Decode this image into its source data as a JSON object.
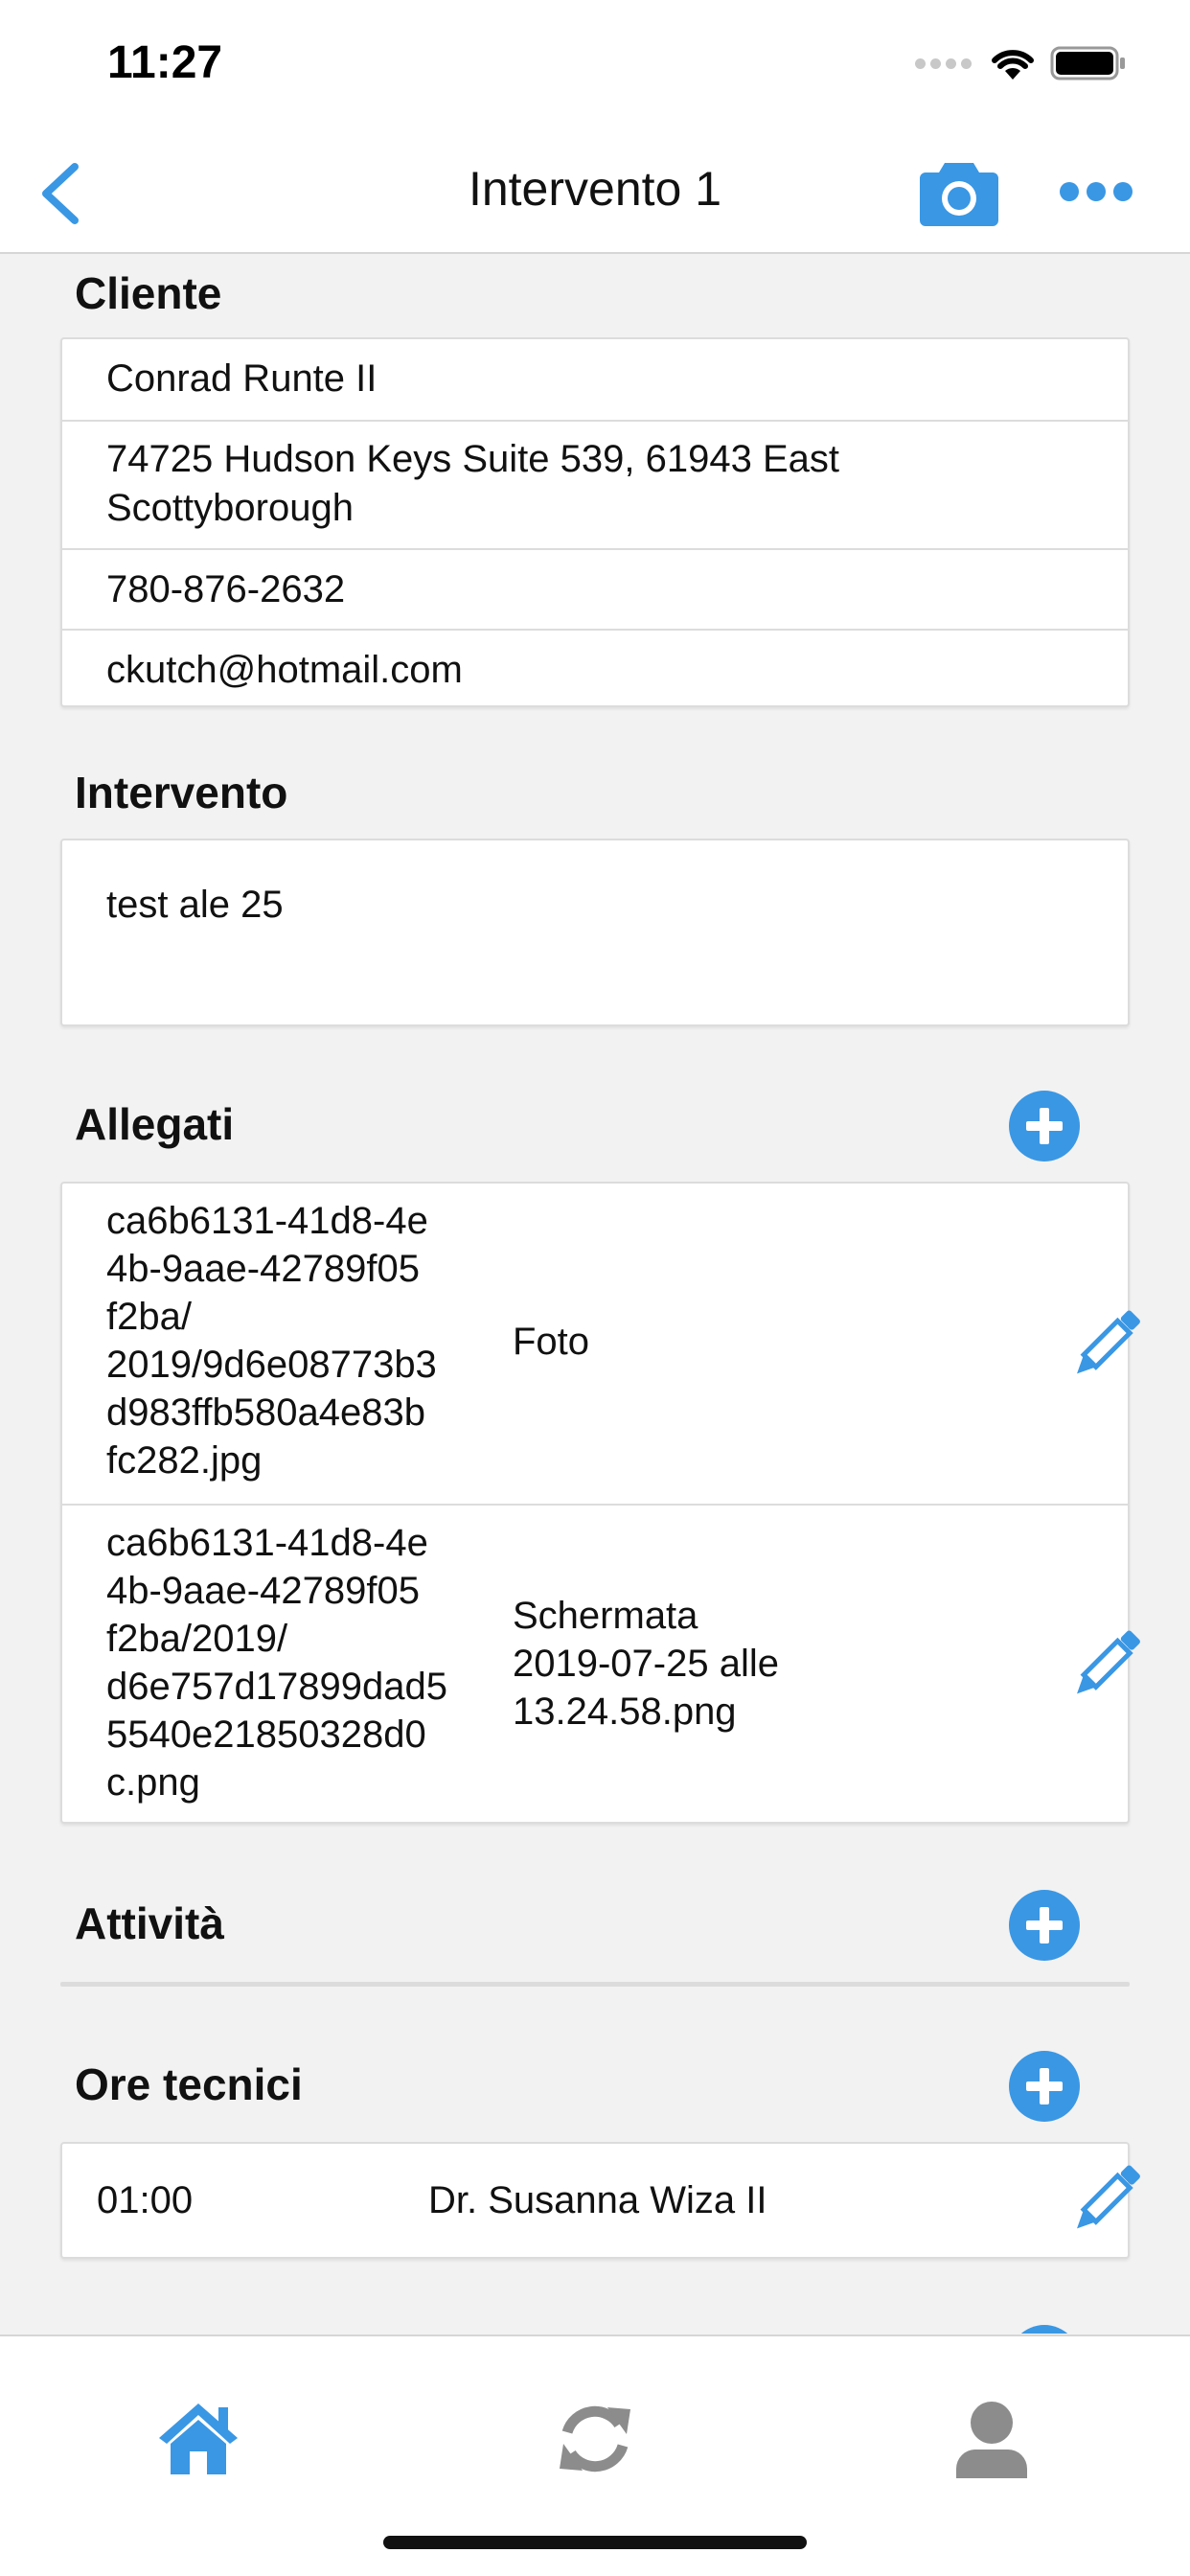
{
  "status_bar": {
    "time": "11:27"
  },
  "nav": {
    "title": "Intervento 1"
  },
  "cliente": {
    "title": "Cliente",
    "name": "Conrad Runte II",
    "address_line1": "74725 Hudson Keys Suite 539, 61943 East",
    "address_line2": "Scottyborough",
    "phone": "780-876-2632",
    "email": "ckutch@hotmail.com"
  },
  "intervento": {
    "title": "Intervento",
    "description": "test ale 25"
  },
  "allegati": {
    "title": "Allegati",
    "items": [
      {
        "path_lines": [
          "ca6b6131-41d8-4e",
          "4b-9aae-42789f05",
          "f2ba/",
          "2019/9d6e08773b3",
          "d983ffb580a4e83b",
          "fc282.jpg"
        ],
        "name_lines": [
          "Foto"
        ]
      },
      {
        "path_lines": [
          "ca6b6131-41d8-4e",
          "4b-9aae-42789f05",
          "f2ba/2019/",
          "d6e757d17899dad5",
          "5540e21850328d0",
          "c.png"
        ],
        "name_lines": [
          "Schermata",
          "2019-07-25 alle",
          "13.24.58.png"
        ]
      }
    ]
  },
  "attivita": {
    "title": "Attività"
  },
  "ore_tecnici": {
    "title": "Ore tecnici",
    "rows": [
      {
        "hours": "01:00",
        "technician": "Dr. Susanna Wiza II"
      }
    ]
  },
  "colors": {
    "accent": "#3a97e4",
    "tab_inactive": "#8c8c8c"
  },
  "tabs": [
    {
      "icon": "home-icon",
      "active": true
    },
    {
      "icon": "sync-icon",
      "active": false
    },
    {
      "icon": "user-icon",
      "active": false
    }
  ]
}
